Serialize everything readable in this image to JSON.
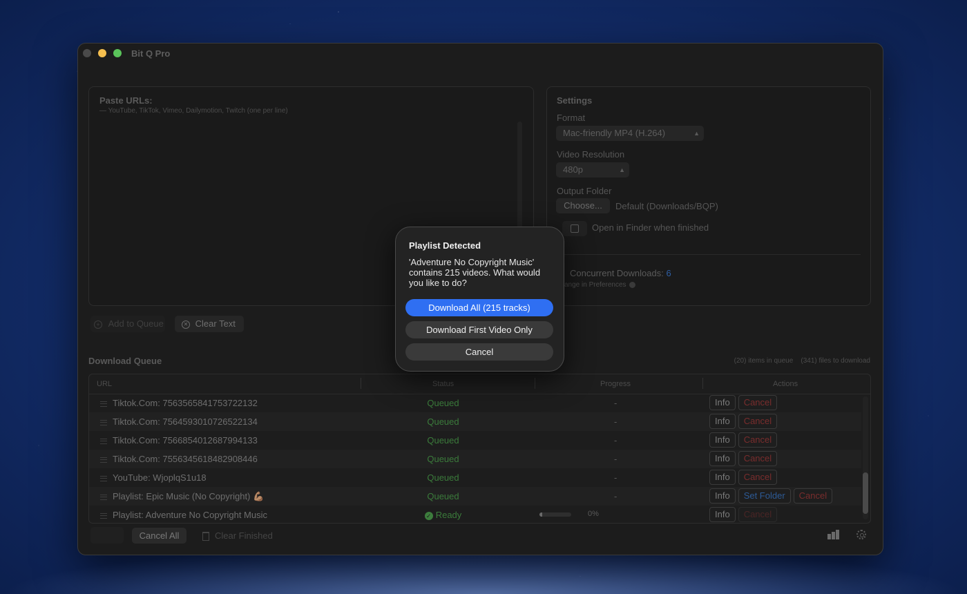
{
  "app": {
    "title": "Bit Q Pro"
  },
  "paste": {
    "title": "Paste URLs:",
    "subtitle": "— YouTube, TikTok, Vimeo, Dailymotion, Twitch (one per line)"
  },
  "settings": {
    "title": "Settings",
    "format_label": "Format",
    "format_value": "Mac-friendly MP4 (H.264)",
    "resolution_label": "Video Resolution",
    "resolution_value": "480p",
    "output_label": "Output Folder",
    "choose_label": "Choose...",
    "output_default": "Default (Downloads/BQP)",
    "open_finder_label": "Open in Finder when finished",
    "concurrent_label": "Concurrent Downloads: ",
    "concurrent_value": "6",
    "prefs_hint": "ange in Preferences"
  },
  "actions": {
    "add_queue": "Add to Queue",
    "clear_text": "Clear Text"
  },
  "queue": {
    "title": "Download Queue",
    "count_text": "(20) items in queue    (341) files to download",
    "columns": [
      "URL",
      "Status",
      "Progress",
      "Actions"
    ],
    "rows": [
      {
        "url": "Tiktok.Com: 7563565841753722132",
        "status": "Queued",
        "progress": "-"
      },
      {
        "url": "Tiktok.Com: 7564593010726522134",
        "status": "Queued",
        "progress": "-"
      },
      {
        "url": "Tiktok.Com: 7566854012687994133",
        "status": "Queued",
        "progress": "-"
      },
      {
        "url": "Tiktok.Com: 7556345618482908446",
        "status": "Queued",
        "progress": "-"
      },
      {
        "url": "YouTube: WjoplqS1u18",
        "status": "Queued",
        "progress": "-"
      },
      {
        "url": "Playlist: Epic Music (No Copyright) 💪🏽",
        "status": "Queued",
        "progress": "-"
      },
      {
        "url": "Playlist: Adventure No Copyright Music",
        "status": "Ready",
        "progress": "0%",
        "progress_fraction": 0.0
      }
    ],
    "info_label": "Info",
    "cancel_label": "Cancel",
    "set_folder_label": "Set Folder"
  },
  "footer": {
    "cancel_all": "Cancel All",
    "clear_finished": "Clear Finished"
  },
  "dialog": {
    "title": "Playlist Detected",
    "message": "'Adventure No Copyright Music' contains 215 videos. What would you like to do?",
    "primary": "Download All (215 tracks)",
    "secondary": "Download First Video Only",
    "cancel": "Cancel"
  },
  "colors": {
    "accent": "#2f6ff2",
    "status_ok": "#3b7b3b",
    "cancel_red": "#7a2d2d"
  },
  "icons": [
    "close-icon",
    "minimize-icon",
    "maximize-icon",
    "plus-circle-icon",
    "x-circle-icon",
    "drag-handle-icon",
    "checkmark-icon",
    "trash-icon",
    "stats-icon",
    "gear-icon",
    "chevron-updown-icon"
  ]
}
